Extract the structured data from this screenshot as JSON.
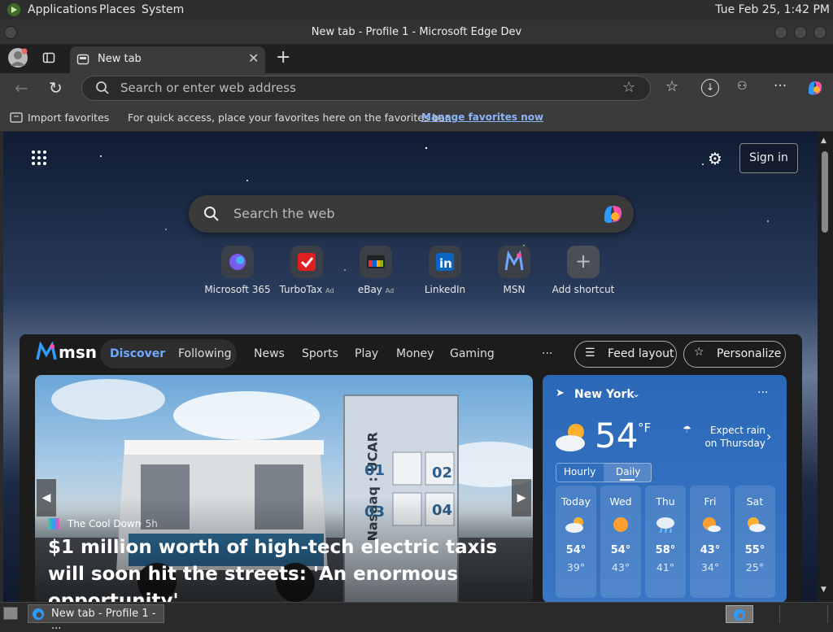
{
  "system_bar": {
    "menus": [
      "Applications",
      "Places",
      "System"
    ],
    "clock": "Tue Feb 25,  1:42 PM"
  },
  "window": {
    "title": "New tab - Profile 1 - Microsoft Edge Dev"
  },
  "tab": {
    "label": "New tab"
  },
  "address_bar": {
    "placeholder": "Search or enter web address"
  },
  "favorites_bar": {
    "import_label": "Import favorites",
    "hint": "For quick access, place your favorites here on the favorites bar.",
    "manage_link": "Manage favorites now"
  },
  "newtab": {
    "sign_in": "Sign in",
    "search_placeholder": "Search the web",
    "shortcuts": [
      {
        "label": "Microsoft 365",
        "ad": ""
      },
      {
        "label": "TurboTax",
        "ad": "Ad"
      },
      {
        "label": "eBay",
        "ad": "Ad"
      },
      {
        "label": "LinkedIn",
        "ad": ""
      },
      {
        "label": "MSN",
        "ad": ""
      },
      {
        "label": "Add shortcut",
        "ad": ""
      }
    ]
  },
  "msn": {
    "logo_text": "msn",
    "tabs": [
      "Discover",
      "Following"
    ],
    "nav": [
      "News",
      "Sports",
      "Play",
      "Money",
      "Gaming"
    ],
    "more": "···",
    "feed_layout": "Feed layout",
    "personalize": "Personalize",
    "hero": {
      "source": "The Cool Down",
      "age": "5h",
      "headline": "$1 million worth of high-tech electric taxis will soon hit the streets: 'An enormous opportunity'",
      "locker_brand": "Nasdaq : UCAR",
      "locker_numbers": [
        "01",
        "02",
        "03",
        "04"
      ]
    },
    "weather": {
      "location": "New York",
      "more": "···",
      "temp": "54",
      "unit": "°F",
      "note": "Expect rain on Thursday",
      "tabs": [
        "Hourly",
        "Daily"
      ],
      "days": [
        {
          "name": "Today",
          "high": "54°",
          "low": "39°",
          "icon": "partly-cloudy-icon"
        },
        {
          "name": "Wed",
          "high": "54°",
          "low": "43°",
          "icon": "sunny-icon"
        },
        {
          "name": "Thu",
          "high": "58°",
          "low": "41°",
          "icon": "rain-icon"
        },
        {
          "name": "Fri",
          "high": "43°",
          "low": "34°",
          "icon": "mostly-sunny-icon"
        },
        {
          "name": "Sat",
          "high": "55°",
          "low": "25°",
          "icon": "partly-cloudy-icon"
        }
      ]
    }
  },
  "taskbar": {
    "window_label": "New tab - Profile 1 - ..."
  },
  "colors": {
    "accent": "#2c68b8",
    "link": "#8ab4f8",
    "discover": "#6fa8ff"
  }
}
